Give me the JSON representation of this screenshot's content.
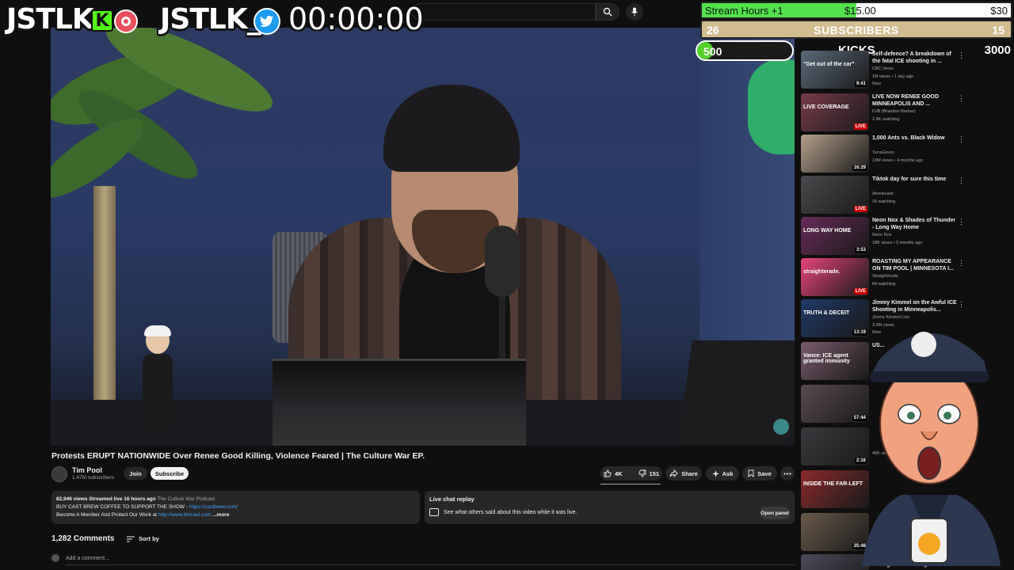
{
  "overlay": {
    "logo1": "JSTLK",
    "logo1_badge": "K",
    "logo2": "JSTLK_",
    "timer": "00:00:00",
    "goal_hours": {
      "label": "Stream Hours +1",
      "current": "$15.00",
      "target": "$30",
      "progress": 0.5
    },
    "goal_subs": {
      "current": "26",
      "label": "SUBSCRIBERS",
      "target": "15"
    },
    "goal_kicks": {
      "current": "500",
      "label": "KICKS",
      "target": "3000",
      "progress": 0.17
    }
  },
  "player": {
    "title": "Protests ERUPT NATIONWIDE Over Renee Good Killing, Violence Feared | The Culture War EP.",
    "channel_name": "Tim Pool",
    "channel_subs": "1.47M subscribers",
    "join_label": "Join",
    "subscribe_label": "Subscribe",
    "likes": "4K",
    "dislikes": "151",
    "share_label": "Share",
    "ask_label": "Ask",
    "save_label": "Save"
  },
  "description": {
    "stats": "82,946 views  Streamed live 16 hours ago",
    "podcast": "The Culture War Podcast",
    "line2_text": "BUY CAST BREW COFFEE TO SUPPORT THE SHOW - ",
    "line2_link": "https://castbrew.com/",
    "line3_text": "Become A Member And Protect Our Work at ",
    "line3_link": "http://www.timcast.com",
    "more": "...more"
  },
  "replay": {
    "title": "Live chat replay",
    "subtitle": "See what others said about this video while it was live.",
    "open_label": "Open panel"
  },
  "comments": {
    "count": "1,282 Comments",
    "sort_label": "Sort by",
    "add_placeholder": "Add a comment..."
  },
  "sidebar": {
    "items": [
      {
        "title": "Self-defence? A breakdown of the fatal ICE shooting in ...",
        "channel": "CBC News",
        "meta": "1M views • 1 day ago",
        "badge": "New",
        "duration": "9:41",
        "thumb_text": "\"Get out of the car\"",
        "thumb_color": "#5a6a7a"
      },
      {
        "title": "LIVE NOW RENEE GOOD MINNEAPOLIS AND ...",
        "channel": "DJB (Brandon Barlow)",
        "meta": "2.4K watching",
        "duration": "LIVE",
        "thumb_text": "LIVE COVERAGE",
        "thumb_color": "#7a3a4a",
        "live": true
      },
      {
        "title": "1,000 Ants vs. Black Widow",
        "channel": "TerraGreen",
        "meta": "19M views • 4 months ago",
        "duration": "16:29",
        "thumb_text": "",
        "thumb_color": "#b5a08a"
      },
      {
        "title": "Tiktok day for sure this time",
        "channel": "Ahrelevant",
        "meta": "20 watching",
        "duration": "LIVE",
        "thumb_text": "",
        "thumb_color": "#4a4a4e",
        "live": true
      },
      {
        "title": "Neon Nox & Shades of Thunder - Long Way Home",
        "channel": "Neon Nox",
        "meta": "18K views • 3 months ago",
        "duration": "3:53",
        "thumb_text": "LONG WAY HOME",
        "thumb_color": "#6a2a5a"
      },
      {
        "title": "ROASTING MY APPEARANCE ON TIM POOL | MINNESOTA I...",
        "channel": "Straighterade",
        "meta": "64 watching",
        "duration": "LIVE",
        "thumb_text": "straighterade.",
        "thumb_color": "#e6447a",
        "live": true
      },
      {
        "title": "Jimmy Kimmel on the Awful ICE Shooting in Minneapolis...",
        "channel": "Jimmy Kimmel Live",
        "meta": "3.4M views",
        "badge": "New",
        "duration": "13:19",
        "thumb_text": "TRUTH & DECEIT",
        "thumb_color": "#1f3a6a"
      },
      {
        "title": "US...",
        "channel": "",
        "meta": "",
        "duration": "",
        "thumb_text": "Vance: ICE agent granted immunity",
        "thumb_color": "#7a5a6a"
      },
      {
        "title": "",
        "channel": "",
        "meta": "",
        "duration": "57:44",
        "thumb_text": "",
        "thumb_color": "#5a4a4e"
      },
      {
        "title": "",
        "channel": "",
        "meta": "46K views",
        "duration": "2:16",
        "thumb_text": "",
        "thumb_color": "#3a3a3e"
      },
      {
        "title": "",
        "channel": "",
        "meta": "",
        "duration": "",
        "thumb_text": "INSIDE THE FAR-LEFT",
        "thumb_color": "#8a2a2a"
      },
      {
        "title": "",
        "channel": "",
        "meta": "",
        "duration": "35:48",
        "thumb_text": "",
        "thumb_color": "#6a5a4a"
      },
      {
        "title": "More Incriminating Footage Of ICE Agent Murdering Mom",
        "channel": "",
        "meta": "",
        "duration": "",
        "thumb_text": "",
        "thumb_color": "#4a4a5a"
      }
    ]
  },
  "colors": {
    "background": "#0f0f0f",
    "kick_green": "#53fc18",
    "twitter_blue": "#1d9bf0",
    "subscribe_bg": "#f1f1f1",
    "link_blue": "#3ea6ff"
  }
}
